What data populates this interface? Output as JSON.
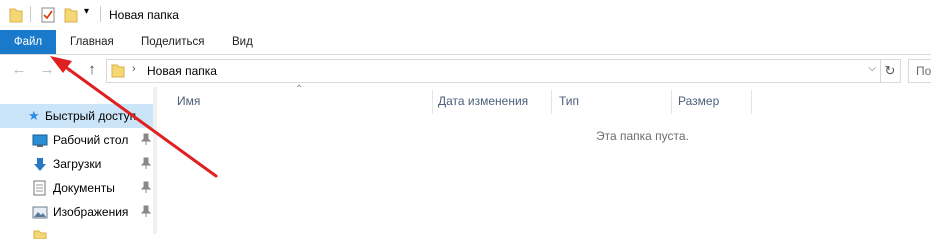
{
  "window": {
    "title": "Новая папка"
  },
  "ribbon": {
    "tabs": [
      {
        "label": "Файл",
        "active": true
      },
      {
        "label": "Главная"
      },
      {
        "label": "Поделиться"
      },
      {
        "label": "Вид"
      }
    ]
  },
  "address": {
    "path": "Новая папка",
    "search_placeholder": "По"
  },
  "navigation": {
    "items": [
      {
        "label": "Быстрый доступ",
        "icon": "star-icon",
        "selected": true
      },
      {
        "label": "Рабочий стол",
        "icon": "desktop-icon",
        "pinned": true
      },
      {
        "label": "Загрузки",
        "icon": "download-icon",
        "pinned": true
      },
      {
        "label": "Документы",
        "icon": "documents-icon",
        "pinned": true
      },
      {
        "label": "Изображения",
        "icon": "images-icon",
        "pinned": true
      }
    ]
  },
  "file_list": {
    "columns": [
      "Имя",
      "Дата изменения",
      "Тип",
      "Размер"
    ],
    "empty_message": "Эта папка пуста."
  },
  "colors": {
    "file_tab": "#1979ca",
    "selection": "#cce4f7",
    "annotation_arrow": "#e02020",
    "header_text": "#4c607a"
  }
}
